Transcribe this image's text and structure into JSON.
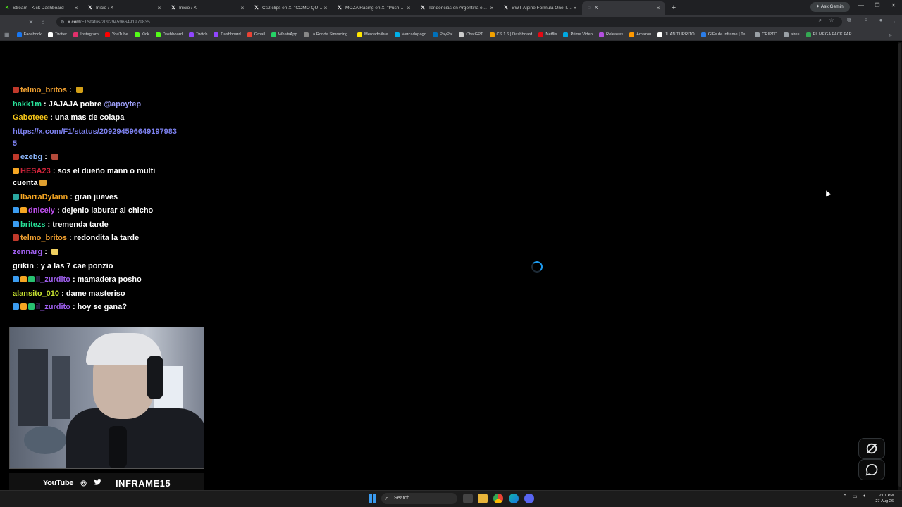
{
  "browser": {
    "tabs": [
      {
        "title": "Stream - Kick Dashboard",
        "icon": "kick-icon",
        "color": "#53fc18",
        "active": false
      },
      {
        "title": "Inicio / X",
        "icon": "x-icon",
        "color": "#ffffff",
        "active": false
      },
      {
        "title": "Inicio / X",
        "icon": "x-icon",
        "color": "#ffffff",
        "active": false
      },
      {
        "title": "Cs2 clips en X: \"COMO QUE EL",
        "icon": "x-icon",
        "color": "#ffffff",
        "active": false
      },
      {
        "title": "MOZA Racing en X: \"Push the li",
        "icon": "x-icon",
        "color": "#ffffff",
        "active": false
      },
      {
        "title": "Tendencias en Argentina en X",
        "icon": "x-icon",
        "color": "#ffffff",
        "active": false
      },
      {
        "title": "BWT Alpine Formula One Team",
        "icon": "x-icon",
        "color": "#ffffff",
        "active": false
      },
      {
        "title": "X",
        "icon": "loading-icon",
        "color": "#9aa0a6",
        "active": true
      }
    ],
    "new_tab": "+",
    "ask_gemini": "Ask Gemini",
    "window_controls": {
      "minimize": "—",
      "maximize": "❐",
      "close": "✕"
    },
    "url_host": "x.com",
    "url_path": "/F1/status/2092945966491979835",
    "bookmarks": [
      {
        "label": "Facebook",
        "color": "#1877f2"
      },
      {
        "label": "Twitter",
        "color": "#ffffff"
      },
      {
        "label": "Instagram",
        "color": "#e1306c"
      },
      {
        "label": "YouTube",
        "color": "#ff0000"
      },
      {
        "label": "Kick",
        "color": "#53fc18"
      },
      {
        "label": "Dashboard",
        "color": "#53fc18"
      },
      {
        "label": "Twitch",
        "color": "#9146ff"
      },
      {
        "label": "Dashboard",
        "color": "#9146ff"
      },
      {
        "label": "Gmail",
        "color": "#ea4335"
      },
      {
        "label": "WhatsApp",
        "color": "#25d366"
      },
      {
        "label": "La Ronda Simracing...",
        "color": "#888888"
      },
      {
        "label": "Mercadolibre",
        "color": "#ffe600"
      },
      {
        "label": "Mercadopago",
        "color": "#00b1ea"
      },
      {
        "label": "PayPal",
        "color": "#0070ba"
      },
      {
        "label": "ChatGPT",
        "color": "#cccccc"
      },
      {
        "label": "CS 1.6 | Dashboard",
        "color": "#f0a000"
      },
      {
        "label": "Netflix",
        "color": "#e50914"
      },
      {
        "label": "Prime Video",
        "color": "#00a8e1"
      },
      {
        "label": "Releases",
        "color": "#b44fe0"
      },
      {
        "label": "Amazon",
        "color": "#ff9900"
      },
      {
        "label": "JUAN TURRITO",
        "color": "#ffffff"
      },
      {
        "label": "GIFs de Inframe | Te...",
        "color": "#2b7de9"
      },
      {
        "label": "CRIPTO",
        "color": "#9aa0a6"
      },
      {
        "label": "aires",
        "color": "#9aa0a6"
      },
      {
        "label": "EL MEGA PACK PAP...",
        "color": "#34a853"
      }
    ],
    "bookmarks_more": "»"
  },
  "chat": [
    {
      "badges": [
        "#c0392b"
      ],
      "user": "telmo_britos",
      "color": "#f0a030",
      "text": "",
      "emote": "#d4a017"
    },
    {
      "badges": [],
      "user": "hakk1m",
      "color": "#28e098",
      "text": "JAJAJA pobre ",
      "mention": "@apoytep"
    },
    {
      "badges": [],
      "user": "Gaboteee",
      "color": "#f5c518",
      "text": "una mas de colapa"
    },
    {
      "badges": [],
      "user": "",
      "color": "#7c80ee",
      "link": "https://x.com/F1/status/2092945966491979835"
    },
    {
      "badges": [
        "#c0392b"
      ],
      "user": "ezebg",
      "color": "#8ab4f8",
      "text": "",
      "emote": "#b34a3a"
    },
    {
      "badges": [
        "#f5a623"
      ],
      "user": "HESA23",
      "color": "#d0243b",
      "text": "sos el dueño mann o multi cuenta",
      "emote": "#e0a030"
    },
    {
      "badges": [
        "#2aa7a0"
      ],
      "user": "IbarraDylann",
      "color": "#f5a623",
      "text": "gran jueves"
    },
    {
      "badges": [
        "#3b9cf0",
        "#f5a623"
      ],
      "user": "dnicely",
      "color": "#c050f0",
      "text": "dejenlo laburar al chicho"
    },
    {
      "badges": [
        "#3b9cf0"
      ],
      "user": "britezs",
      "color": "#28e098",
      "text": "tremenda tarde"
    },
    {
      "badges": [
        "#c0392b"
      ],
      "user": "telmo_britos",
      "color": "#f0a030",
      "text": "redondita la tarde"
    },
    {
      "badges": [],
      "user": "zennarg",
      "color": "#a060f0",
      "text": "",
      "emote": "#f0d060"
    },
    {
      "badges": [],
      "user": "grikin",
      "color": "#ffffff",
      "text": "y a las 7 cae ponzio"
    },
    {
      "badges": [
        "#3b9cf0",
        "#f5a623",
        "#28c070"
      ],
      "user": "il_zurdito",
      "color": "#a060f0",
      "text": "mamadera posho"
    },
    {
      "badges": [],
      "user": "alansito_010",
      "color": "#c5e030",
      "text": "dame masteriso"
    },
    {
      "badges": [
        "#3b9cf0",
        "#f5a623",
        "#28c070"
      ],
      "user": "il_zurdito",
      "color": "#a060f0",
      "text": "hoy se gana?"
    }
  ],
  "webcam": {
    "youtube": "YouTube",
    "instagram_icon": "◎",
    "twitter_icon": "🐦",
    "handle": "INFRAME15"
  },
  "taskbar": {
    "search_placeholder": "Search",
    "time": "2:01 PM",
    "date": "27-Aug-26"
  },
  "colors": {
    "accent": "#1d9bf0",
    "background": "#000000"
  }
}
